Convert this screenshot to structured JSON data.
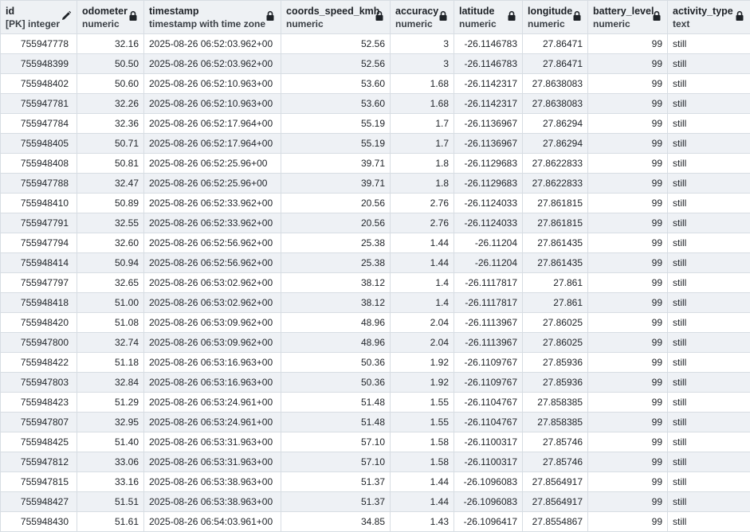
{
  "columns": [
    {
      "name": "id",
      "type": "[PK] integer",
      "icon": "pencil-icon"
    },
    {
      "name": "odometer",
      "type": "numeric",
      "icon": "lock-icon"
    },
    {
      "name": "timestamp",
      "type": "timestamp with time zone",
      "icon": "lock-icon"
    },
    {
      "name": "coords_speed_kmh",
      "type": "numeric",
      "icon": "lock-icon"
    },
    {
      "name": "accuracy",
      "type": "numeric",
      "icon": "lock-icon"
    },
    {
      "name": "latitude",
      "type": "numeric",
      "icon": "lock-icon"
    },
    {
      "name": "longitude",
      "type": "numeric",
      "icon": "lock-icon"
    },
    {
      "name": "battery_level",
      "type": "numeric",
      "icon": "lock-icon"
    },
    {
      "name": "activity_type",
      "type": "text",
      "icon": "lock-icon"
    }
  ],
  "rows": [
    [
      "755947778",
      "32.16",
      "2025-08-26 06:52:03.962+00",
      "52.56",
      "3",
      "-26.1146783",
      "27.86471",
      "99",
      "still"
    ],
    [
      "755948399",
      "50.50",
      "2025-08-26 06:52:03.962+00",
      "52.56",
      "3",
      "-26.1146783",
      "27.86471",
      "99",
      "still"
    ],
    [
      "755948402",
      "50.60",
      "2025-08-26 06:52:10.963+00",
      "53.60",
      "1.68",
      "-26.1142317",
      "27.8638083",
      "99",
      "still"
    ],
    [
      "755947781",
      "32.26",
      "2025-08-26 06:52:10.963+00",
      "53.60",
      "1.68",
      "-26.1142317",
      "27.8638083",
      "99",
      "still"
    ],
    [
      "755947784",
      "32.36",
      "2025-08-26 06:52:17.964+00",
      "55.19",
      "1.7",
      "-26.1136967",
      "27.86294",
      "99",
      "still"
    ],
    [
      "755948405",
      "50.71",
      "2025-08-26 06:52:17.964+00",
      "55.19",
      "1.7",
      "-26.1136967",
      "27.86294",
      "99",
      "still"
    ],
    [
      "755948408",
      "50.81",
      "2025-08-26 06:52:25.96+00",
      "39.71",
      "1.8",
      "-26.1129683",
      "27.8622833",
      "99",
      "still"
    ],
    [
      "755947788",
      "32.47",
      "2025-08-26 06:52:25.96+00",
      "39.71",
      "1.8",
      "-26.1129683",
      "27.8622833",
      "99",
      "still"
    ],
    [
      "755948410",
      "50.89",
      "2025-08-26 06:52:33.962+00",
      "20.56",
      "2.76",
      "-26.1124033",
      "27.861815",
      "99",
      "still"
    ],
    [
      "755947791",
      "32.55",
      "2025-08-26 06:52:33.962+00",
      "20.56",
      "2.76",
      "-26.1124033",
      "27.861815",
      "99",
      "still"
    ],
    [
      "755947794",
      "32.60",
      "2025-08-26 06:52:56.962+00",
      "25.38",
      "1.44",
      "-26.11204",
      "27.861435",
      "99",
      "still"
    ],
    [
      "755948414",
      "50.94",
      "2025-08-26 06:52:56.962+00",
      "25.38",
      "1.44",
      "-26.11204",
      "27.861435",
      "99",
      "still"
    ],
    [
      "755947797",
      "32.65",
      "2025-08-26 06:53:02.962+00",
      "38.12",
      "1.4",
      "-26.1117817",
      "27.861",
      "99",
      "still"
    ],
    [
      "755948418",
      "51.00",
      "2025-08-26 06:53:02.962+00",
      "38.12",
      "1.4",
      "-26.1117817",
      "27.861",
      "99",
      "still"
    ],
    [
      "755948420",
      "51.08",
      "2025-08-26 06:53:09.962+00",
      "48.96",
      "2.04",
      "-26.1113967",
      "27.86025",
      "99",
      "still"
    ],
    [
      "755947800",
      "32.74",
      "2025-08-26 06:53:09.962+00",
      "48.96",
      "2.04",
      "-26.1113967",
      "27.86025",
      "99",
      "still"
    ],
    [
      "755948422",
      "51.18",
      "2025-08-26 06:53:16.963+00",
      "50.36",
      "1.92",
      "-26.1109767",
      "27.85936",
      "99",
      "still"
    ],
    [
      "755947803",
      "32.84",
      "2025-08-26 06:53:16.963+00",
      "50.36",
      "1.92",
      "-26.1109767",
      "27.85936",
      "99",
      "still"
    ],
    [
      "755948423",
      "51.29",
      "2025-08-26 06:53:24.961+00",
      "51.48",
      "1.55",
      "-26.1104767",
      "27.858385",
      "99",
      "still"
    ],
    [
      "755947807",
      "32.95",
      "2025-08-26 06:53:24.961+00",
      "51.48",
      "1.55",
      "-26.1104767",
      "27.858385",
      "99",
      "still"
    ],
    [
      "755948425",
      "51.40",
      "2025-08-26 06:53:31.963+00",
      "57.10",
      "1.58",
      "-26.1100317",
      "27.85746",
      "99",
      "still"
    ],
    [
      "755947812",
      "33.06",
      "2025-08-26 06:53:31.963+00",
      "57.10",
      "1.58",
      "-26.1100317",
      "27.85746",
      "99",
      "still"
    ],
    [
      "755947815",
      "33.16",
      "2025-08-26 06:53:38.963+00",
      "51.37",
      "1.44",
      "-26.1096083",
      "27.8564917",
      "99",
      "still"
    ],
    [
      "755948427",
      "51.51",
      "2025-08-26 06:53:38.963+00",
      "51.37",
      "1.44",
      "-26.1096083",
      "27.8564917",
      "99",
      "still"
    ],
    [
      "755948430",
      "51.61",
      "2025-08-26 06:54:03.961+00",
      "34.85",
      "1.43",
      "-26.1096417",
      "27.8554867",
      "99",
      "still"
    ]
  ]
}
